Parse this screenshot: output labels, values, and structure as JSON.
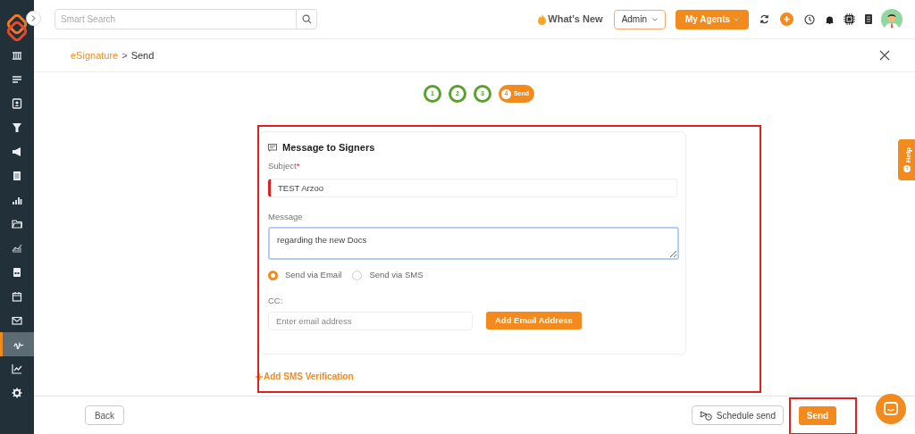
{
  "sidebar": {
    "items": [
      {
        "selected": false
      },
      {
        "selected": false
      },
      {
        "selected": false
      },
      {
        "selected": false
      },
      {
        "selected": false
      },
      {
        "selected": false
      },
      {
        "selected": false
      },
      {
        "selected": false
      },
      {
        "selected": false
      },
      {
        "selected": false
      },
      {
        "selected": false
      },
      {
        "selected": false
      },
      {
        "selected": true
      },
      {
        "selected": false
      },
      {
        "selected": false
      }
    ]
  },
  "topbar": {
    "search": {
      "placeholder": "Smart Search"
    },
    "whats_new": "What's New",
    "role": "Admin",
    "agents": "My Agents"
  },
  "breadcrumb": [
    {
      "label": "eSignature",
      "kind": "link"
    },
    {
      "label": ">",
      "kind": "separator"
    },
    {
      "label": "Send",
      "kind": "current"
    }
  ],
  "steps": [
    {
      "label": "1",
      "completed": true,
      "selected": false
    },
    {
      "label": "2",
      "completed": true,
      "selected": false
    },
    {
      "label": "3",
      "completed": true,
      "selected": false
    },
    {
      "label": "4",
      "title": "Send",
      "completed": false,
      "selected": true
    }
  ],
  "help_tab": "Help",
  "message_card": {
    "title": "Message to Signers",
    "subject": {
      "label": "Subject",
      "required_mark": "*",
      "value": "TEST Arzoo",
      "invalid": true
    },
    "message": {
      "label": "Message",
      "value": "regarding the new Docs",
      "focused": true
    },
    "send_options": [
      {
        "label": "Send via Email",
        "selected": true
      },
      {
        "label": "Send via SMS",
        "selected": false
      }
    ],
    "cc": {
      "label": "CC:",
      "placeholder": "Enter email address",
      "button": "Add Email Address"
    }
  },
  "add_sms_verification": "Add SMS Verification",
  "footer": {
    "back": "Back",
    "schedule": "Schedule send",
    "send": "Send"
  }
}
